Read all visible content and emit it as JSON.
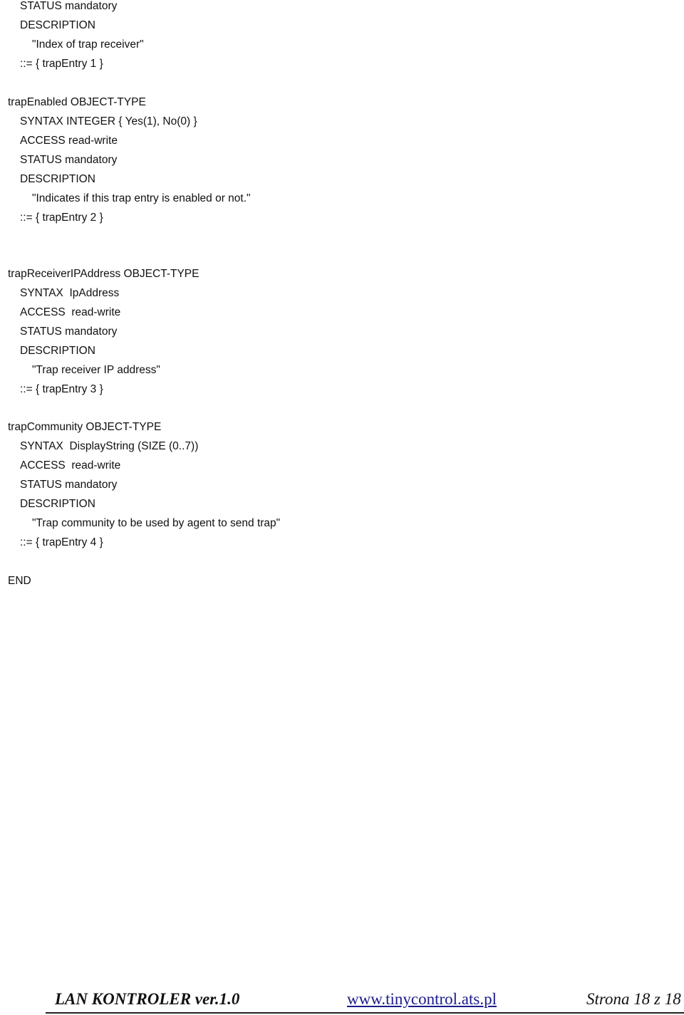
{
  "document": {
    "lines": [
      {
        "indent": 1,
        "text": "STATUS mandatory"
      },
      {
        "indent": 1,
        "text": "DESCRIPTION"
      },
      {
        "indent": 2,
        "text": "\"Index of trap receiver\""
      },
      {
        "indent": 1,
        "text": "::= { trapEntry 1 }"
      },
      {
        "indent": 0,
        "text": "trapEnabled OBJECT-TYPE"
      },
      {
        "indent": 1,
        "text": "SYNTAX INTEGER { Yes(1), No(0) }"
      },
      {
        "indent": 1,
        "text": "ACCESS read-write"
      },
      {
        "indent": 1,
        "text": "STATUS mandatory"
      },
      {
        "indent": 1,
        "text": "DESCRIPTION"
      },
      {
        "indent": 2,
        "text": "\"Indicates if this trap entry is enabled or not.\""
      },
      {
        "indent": 1,
        "text": "::= { trapEntry 2 }"
      },
      {
        "indent": 0,
        "text": "trapReceiverIPAddress OBJECT-TYPE"
      },
      {
        "indent": 1,
        "text": "SYNTAX  IpAddress"
      },
      {
        "indent": 1,
        "text": "ACCESS  read-write"
      },
      {
        "indent": 1,
        "text": "STATUS mandatory"
      },
      {
        "indent": 1,
        "text": "DESCRIPTION"
      },
      {
        "indent": 2,
        "text": "\"Trap receiver IP address\""
      },
      {
        "indent": 1,
        "text": "::= { trapEntry 3 }"
      },
      {
        "indent": 0,
        "text": "trapCommunity OBJECT-TYPE"
      },
      {
        "indent": 1,
        "text": "SYNTAX  DisplayString (SIZE (0..7))"
      },
      {
        "indent": 1,
        "text": "ACCESS  read-write"
      },
      {
        "indent": 1,
        "text": "STATUS mandatory"
      },
      {
        "indent": 1,
        "text": "DESCRIPTION"
      },
      {
        "indent": 2,
        "text": "\"Trap community to be used by agent to send trap\""
      },
      {
        "indent": 1,
        "text": "::= { trapEntry 4 }"
      },
      {
        "indent": 0,
        "text": "END"
      }
    ]
  },
  "footer": {
    "title": "LAN KONTROLER  ver.1.0",
    "url": "www.tinycontrol.ats.pl",
    "page": "Strona 18 z 18"
  }
}
